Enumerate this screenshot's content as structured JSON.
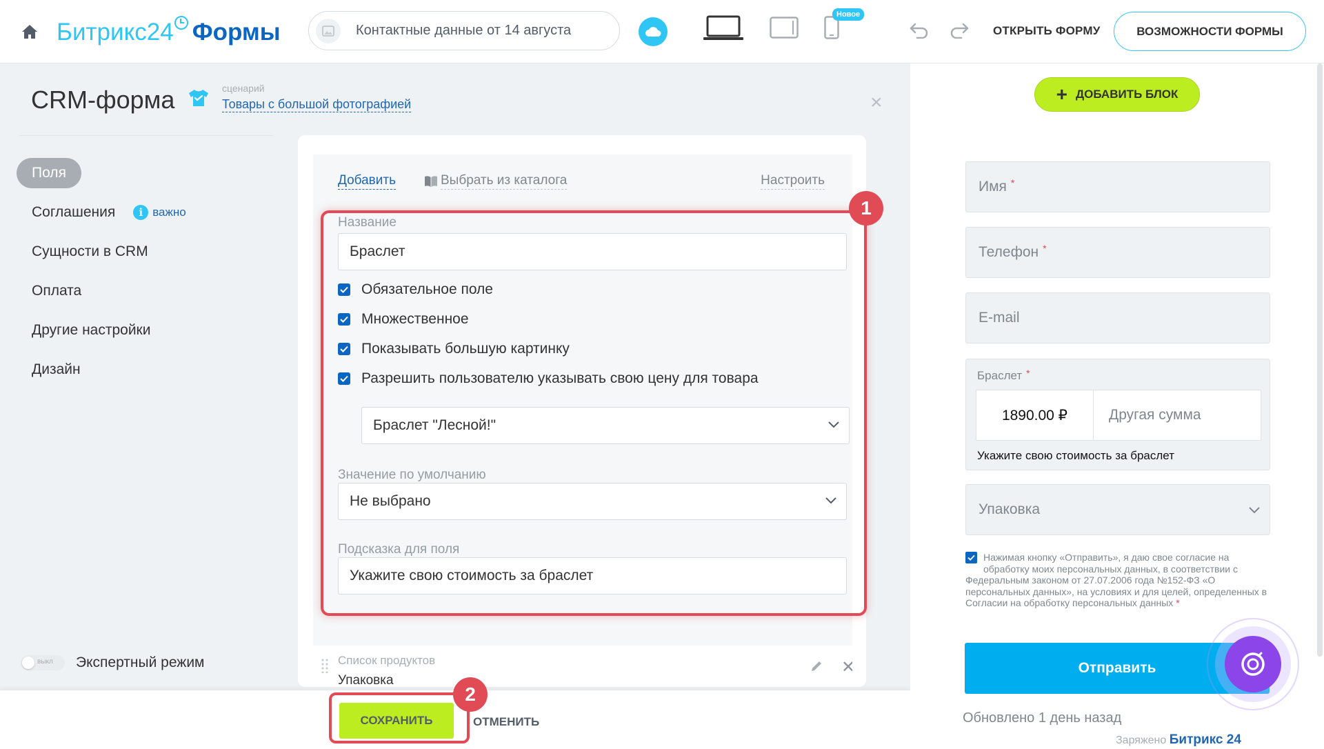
{
  "header": {
    "brand": "Битрикс24",
    "section": "Формы",
    "form_name": "Контактные данные от 14 августа",
    "new_badge": "Новое",
    "open_form": "ОТКРЫТЬ ФОРМУ",
    "form_features": "ВОЗМОЖНОСТИ ФОРМЫ"
  },
  "editor": {
    "title": "CRM-форма",
    "scenario_caption": "сценарий",
    "scenario_link": "Товары с большой фотографией",
    "nav": [
      {
        "label": "Поля",
        "active": true
      },
      {
        "label": "Соглашения",
        "badge": "важно"
      },
      {
        "label": "Сущности в CRM"
      },
      {
        "label": "Оплата"
      },
      {
        "label": "Другие настройки"
      },
      {
        "label": "Дизайн"
      }
    ],
    "expert_toggle_state": "выкл",
    "expert_mode_label": "Экспертный режим",
    "tabs": {
      "add": "Добавить",
      "catalog": "Выбрать из каталога",
      "setup": "Настроить"
    },
    "field": {
      "name_label": "Название",
      "name_value": "Браслет",
      "checkboxes": [
        {
          "label": "Обязательное поле",
          "checked": true
        },
        {
          "label": "Множественное",
          "checked": true
        },
        {
          "label": "Показывать большую картинку",
          "checked": true
        },
        {
          "label": "Разрешить пользователю указывать свою цену для товара",
          "checked": true
        }
      ],
      "product_select": "Браслет \"Лесной!\"",
      "default_label": "Значение по умолчанию",
      "default_value": "Не выбрано",
      "hint_label": "Подсказка для поля",
      "hint_value": "Укажите свою стоимость за браслет"
    },
    "next_field": {
      "label": "Список продуктов",
      "value": "Упаковка"
    },
    "steps": {
      "one": "1",
      "two": "2"
    }
  },
  "footer": {
    "save": "СОХРАНИТЬ",
    "cancel": "ОТМЕНИТЬ"
  },
  "preview": {
    "add_block": "ДОБАВИТЬ БЛОК",
    "fields": {
      "name": "Имя",
      "phone": "Телефон",
      "email": "E-mail"
    },
    "product": {
      "label": "Браслет",
      "price": "1890.00 ₽",
      "other": "Другая сумма",
      "hint": "Укажите свою стоимость за браслет"
    },
    "packaging": "Упаковка",
    "consent": "Нажимая кнопку «Отправить», я даю свое согласие на обработку моих персональных данных, в соответствии с Федеральным законом от 27.07.2006 года №152-ФЗ «О персональных данных», на условиях и для целей, определенных в Согласии на обработку персональных данных",
    "required_mark": "*",
    "submit": "Отправить",
    "updated": "Обновлено 1 день назад",
    "powered_prefix": "Заряжено",
    "powered_brand": "Битрикс 24"
  },
  "colors": {
    "accent": "#2fc6f6",
    "primary_blue": "#0b66c3",
    "lime": "#bbed21",
    "highlight_red": "#e04b55",
    "submit_blue": "#00aeef"
  }
}
